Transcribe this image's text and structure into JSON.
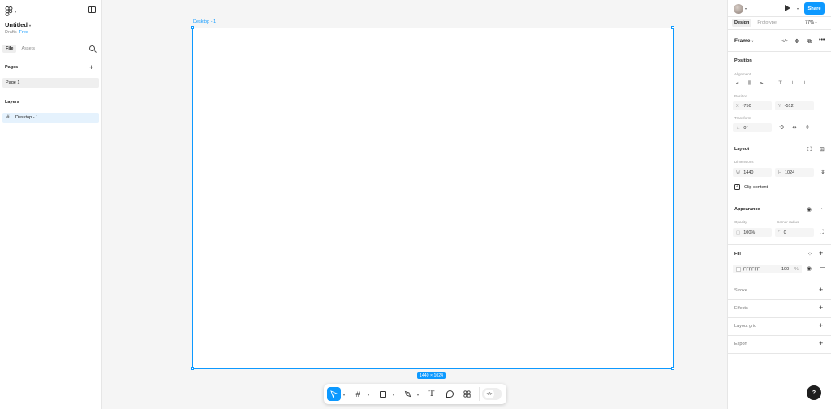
{
  "app": {
    "file_title": "Untitled",
    "drafts_label": "Drafts",
    "plan_badge": "Free"
  },
  "left_panel": {
    "tabs": [
      "File",
      "Assets"
    ],
    "pages_title": "Pages",
    "pages": [
      "Page 1"
    ],
    "layers_title": "Layers",
    "layers": [
      "Desktop - 1"
    ]
  },
  "canvas": {
    "frame_label": "Desktop - 1",
    "frame_size": "1440 × 1024"
  },
  "toolbar": {
    "tools": [
      "move-tool",
      "frame-tool",
      "rectangle-tool",
      "pen-tool",
      "text-tool",
      "comment-tool",
      "actions-tool",
      "dev-mode-toggle"
    ]
  },
  "right_panel": {
    "share_label": "Share",
    "tabs": [
      "Design",
      "Prototype"
    ],
    "zoom": "77%",
    "frame_selector": "Frame",
    "position": {
      "title": "Position",
      "alignment_label": "Alignment",
      "position_label": "Position",
      "x_prefix": "X",
      "x": "-750",
      "y_prefix": "Y",
      "y": "-512",
      "transform_label": "Transform",
      "rotation": "0°"
    },
    "layout": {
      "title": "Layout",
      "dimensions_label": "Dimensions",
      "w_prefix": "W",
      "width": "1440",
      "h_prefix": "H",
      "height": "1024",
      "clip_content": "Clip content"
    },
    "appearance": {
      "title": "Appearance",
      "opacity_label": "Opacity",
      "opacity": "100%",
      "corner_radius_label": "Corner radius",
      "corner_radius": "0"
    },
    "fill": {
      "title": "Fill",
      "hex": "FFFFFF",
      "opacity": "100",
      "unit": "%"
    },
    "sections": [
      "Stroke",
      "Effects",
      "Layout grid",
      "Export"
    ]
  },
  "colors": {
    "accent": "#0d99ff",
    "canvas_bg": "#f5f5f5",
    "frame_fill": "#ffffff"
  },
  "help_label": "?"
}
